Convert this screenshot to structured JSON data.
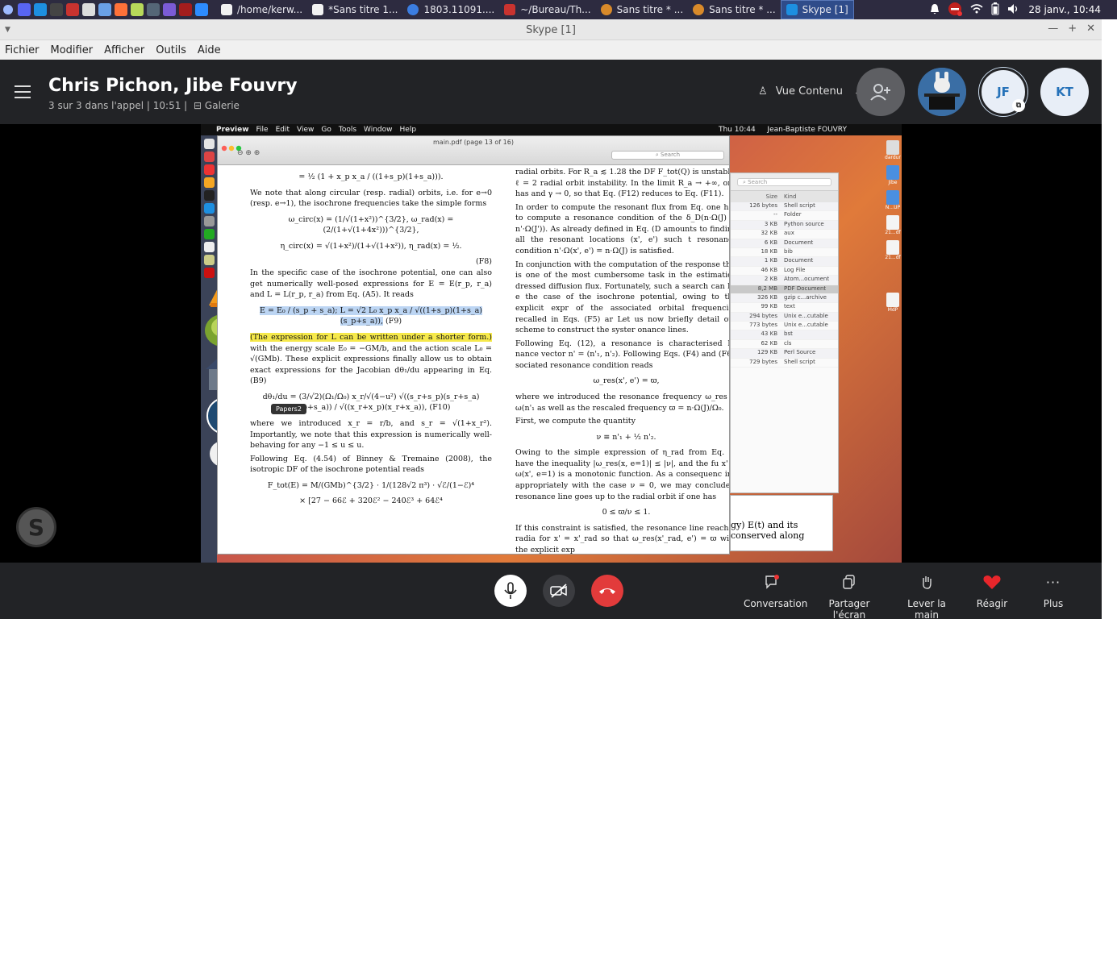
{
  "taskbar": {
    "tasks": [
      {
        "label": "/home/kerw...",
        "color": "#f2f2f2"
      },
      {
        "label": "*Sans titre 1...",
        "color": "#f2f2f2"
      },
      {
        "label": "1803.11091....",
        "color": "#3b7de0"
      },
      {
        "label": "~/Bureau/Th...",
        "color": "#c9332f"
      },
      {
        "label": "Sans titre * ...",
        "color": "#d98a2a"
      },
      {
        "label": "Sans titre * ...",
        "color": "#d98a2a"
      },
      {
        "label": "Skype [1]",
        "color": "#1d8fe1",
        "active": true
      }
    ],
    "clock": "28 janv., 10:44"
  },
  "window": {
    "title": "Skype [1]",
    "menu": [
      "Fichier",
      "Modifier",
      "Afficher",
      "Outils",
      "Aide"
    ]
  },
  "call": {
    "title": "Chris Pichon, Jibe Fouvry",
    "status": "3 sur 3 dans l'appel | 10:51 |",
    "gallery": "Galerie",
    "view_mode": "Vue Contenu",
    "avatars": {
      "jf": "JF",
      "kt": "KT"
    }
  },
  "shared_screen": {
    "mac_menu": [
      "Preview",
      "File",
      "Edit",
      "View",
      "Go",
      "Tools",
      "Window",
      "Help"
    ],
    "mac_clock": "Thu 10:44",
    "mac_user": "Jean-Baptiste FOUVRY",
    "pdf_title": "main.pdf (page 13 of 16)",
    "search_placeholder": "Search",
    "tooltip": "Papers2",
    "left_column": {
      "eq_top": "= ½ (1 + x_p x_a / ((1+s_p)(1+s_a))).",
      "p1": "We note that along circular (resp. radial) orbits, i.e. for e→0 (resp. e→1), the isochrone frequencies take the simple forms",
      "eq_f8a": "ω_circ(x) = (1/√(1+x²))^{3/2},   ω_rad(x) = (2/(1+√(1+4x²)))^{3/2},",
      "eq_f8b": "η_circ(x) = √(1+x²)/(1+√(1+x²)),   η_rad(x) = ½.",
      "tag_f8": "(F8)",
      "p2": "In the specific case of the isochrone potential, one can also get numerically well-posed expressions for E = E(r_p, r_a) and L = L(r_p, r_a) from Eq. (A5). It reads",
      "eq_f9": "E = E₀ / (s_p + s_a);  L = √2 L₀ x_p x_a / √((1+s_p)(1+s_a)(s_p+s_a)),",
      "tag_f9": "(F9)",
      "p3_highlight": "(The expression for L can be written under a shorter form.)",
      "p3_rest": " with the energy scale E₀ = −GM/b, and the action scale L₀ = √(GMb). These explicit expressions finally allow us to obtain exact expressions for the Jacobian dθ₁/du appearing in Eq. (B9)",
      "eq_f10": "dθ₁/du = (3/√2)(Ω₁/Ω₀) x_r/√(4−u²) √((s_r+s_p)(s_r+s_a)(s_p+s_a)) / √((x_r+x_p)(x_r+x_a)),",
      "tag_f10": "(F10)",
      "p4": "where we introduced x_r = r/b, and s_r = √(1+x_r²). Importantly, we note that this expression is numerically well-behaving for any −1 ≤ u ≤ u.",
      "p5": "Following Eq. (4.54) of Binney & Tremaine (2008), the isotropic DF of the isochrone potential reads",
      "eq_ftot": "F_tot(E) = M/(GMb)^{3/2} · 1/(128√2 π³) · √ℰ/(1−ℰ)⁴",
      "eq_ftot2": "× [27 − 66ℰ + 320ℰ² − 240ℰ³ + 64ℰ⁴"
    },
    "right_column": {
      "p1": "radial orbits. For R_a ≲ 1.28 the DF F_tot(Q) is unstable. ℓ = 2 radial orbit instability. In the limit R_a → +∞, one has and γ → 0, so that Eq. (F12) reduces to Eq. (F11).",
      "p2": "In order to compute the resonant flux from Eq. one has to compute a resonance condition of the δ_D(n·Ω(J) − n'·Ω(J')). As already defined in Eq. (D amounts to finding all the resonant locations (x', e') such t resonance condition n'·Ω(x', e') = n·Ω(J) is satisfied.",
      "p3": "In conjunction with the computation of the response this is one of the most cumbersome task in the estimation dressed diffusion flux. Fortunately, such a search can be e the case of the isochrone potential, owing to the explicit expr of the associated orbital frequencies recalled in Eqs. (F5) ar Let us now briefly detail our scheme to construct the syster onance lines.",
      "p4": "Following Eq. (12), a resonance is characterised by nance vector n' = (n'₁, n'₂). Following Eqs. (F4) and (F6), sociated resonance condition reads",
      "eq1": "ω_res(x', e') = ϖ,",
      "p5": "where we introduced the resonance frequency ω_res = ω(n'₁ as well as the rescaled frequency ϖ = n·Ω(J)/Ω₀.",
      "p6": "First, we compute the quantity",
      "eq2": "ν ≡ n'₁ + ½ n'₂.",
      "p7": "Owing to the simple expression of η_rad from Eq. (F have the inequality |ω_res(x, e=1)| ≤ |ν|, and the fu x' ↦ ω(x', e=1) is a monotonic function. As a consequenc ing appropriately with the case ν = 0, we may conclude t resonance line goes up to the radial orbit if one has",
      "eq3": "0 ≤ ϖ/ν ≤ 1.",
      "p8": "If this constraint is satisfied, the resonance line reaches radia for x' = x'_rad so that ω_res(x'_rad, e') = ϖ with the explicit exp"
    },
    "finder": {
      "search_placeholder": "Search",
      "col_size": "Size",
      "col_kind": "Kind",
      "rows": [
        {
          "size": "126 bytes",
          "kind": "Shell script"
        },
        {
          "size": "--",
          "kind": "Folder"
        },
        {
          "size": "3 KB",
          "kind": "Python source"
        },
        {
          "size": "32 KB",
          "kind": "aux"
        },
        {
          "size": "6 KB",
          "kind": "Document"
        },
        {
          "size": "18 KB",
          "kind": "bib"
        },
        {
          "size": "1 KB",
          "kind": "Document"
        },
        {
          "size": "46 KB",
          "kind": "Log File"
        },
        {
          "size": "2 KB",
          "kind": "Atom...ocument"
        },
        {
          "size": "8,2 MB",
          "kind": "PDF Document"
        },
        {
          "size": "326 KB",
          "kind": "gzip c...archive"
        },
        {
          "size": "99 KB",
          "kind": "text"
        },
        {
          "size": "294 bytes",
          "kind": "Unix e...cutable"
        },
        {
          "size": "773 bytes",
          "kind": "Unix e...cutable"
        },
        {
          "size": "43 KB",
          "kind": "bst"
        },
        {
          "size": "62 KB",
          "kind": "cls"
        },
        {
          "size": "129 KB",
          "kind": "Perl Source"
        },
        {
          "size": "729 bytes",
          "kind": "Shell script"
        }
      ]
    },
    "under_window_text1": "gy) E(t) and its",
    "under_window_text2": "conserved along",
    "desktop_labels": [
      "dardur",
      "Jibe",
      "N...UP",
      "21...df",
      "21...df",
      "MdP"
    ]
  },
  "controls": {
    "conversation": "Conversation",
    "share": "Partager l'écran",
    "raise_hand": "Lever la main",
    "react": "Réagir",
    "more": "Plus"
  }
}
